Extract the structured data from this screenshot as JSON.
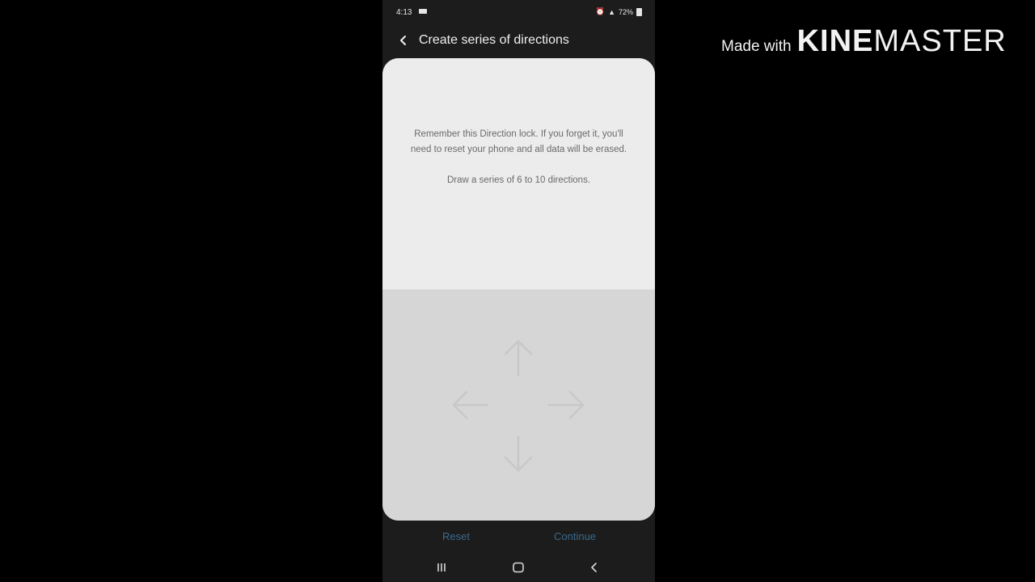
{
  "status_bar": {
    "time": "4:13",
    "battery": "72%"
  },
  "app_bar": {
    "title": "Create series of directions"
  },
  "card": {
    "warning_text": "Remember this Direction lock. If you forget it, you'll need to reset your phone and all data will be erased.",
    "instruction_text": "Draw a series of 6 to 10 directions."
  },
  "actions": {
    "reset_label": "Reset",
    "continue_label": "Continue"
  },
  "watermark": {
    "prefix": "Made with",
    "brand_bold": "KINE",
    "brand_regular": "MASTER"
  },
  "icons": {
    "back": "back-arrow-icon",
    "pad": [
      "arrow-up-icon",
      "arrow-left-icon",
      "arrow-right-icon",
      "arrow-down-icon"
    ],
    "nav": [
      "recents-icon",
      "home-icon",
      "nav-back-icon"
    ]
  },
  "colors": {
    "background": "#000000",
    "phone_background": "#1c1c1c",
    "card_top": "#ececec",
    "pad_area": "#d6d6d6",
    "action_text": "#3a6a8e",
    "watermark": "#f2f2f2"
  }
}
